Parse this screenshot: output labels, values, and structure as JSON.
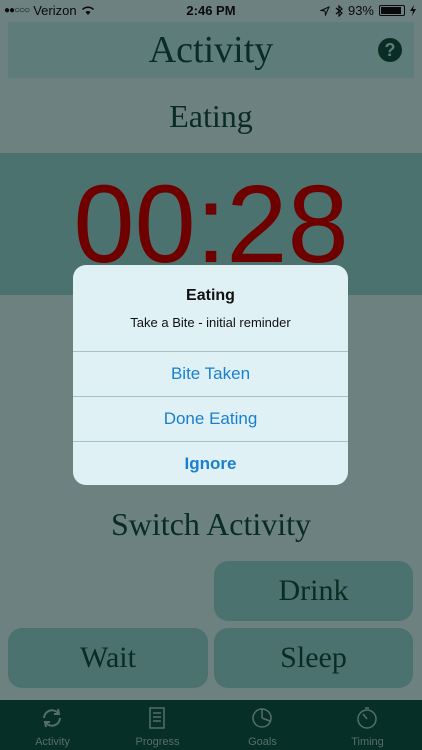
{
  "status_bar": {
    "signal": "●●○○○",
    "carrier": "Verizon",
    "wifi_icon": "wifi-icon",
    "time": "2:46 PM",
    "location_icon": "location-arrow-icon",
    "bluetooth_icon": "bluetooth-icon",
    "battery": "93%",
    "battery_level": 0.93,
    "charging_icon": "charging-icon"
  },
  "header": {
    "title": "Activity",
    "help_label": "?"
  },
  "current_activity": "Eating",
  "timer": "00:28",
  "switch_section": {
    "title": "Switch Activity",
    "buttons": {
      "drink": "Drink",
      "wait": "Wait",
      "sleep": "Sleep"
    }
  },
  "tabbar": {
    "tabs": [
      {
        "label": "Activity",
        "icon": "refresh-cycle-icon"
      },
      {
        "label": "Progress",
        "icon": "report-icon"
      },
      {
        "label": "Goals",
        "icon": "pie-icon"
      },
      {
        "label": "Timing",
        "icon": "stopwatch-icon"
      }
    ]
  },
  "alert": {
    "title": "Eating",
    "message": "Take a Bite - initial reminder",
    "buttons": [
      "Bite Taken",
      "Done Eating",
      "Ignore"
    ]
  },
  "colors": {
    "primary_text": "#0f4a3c",
    "timer": "#b80000",
    "tabbar": "#0b4f42",
    "alert_button": "#1a7fcf"
  }
}
